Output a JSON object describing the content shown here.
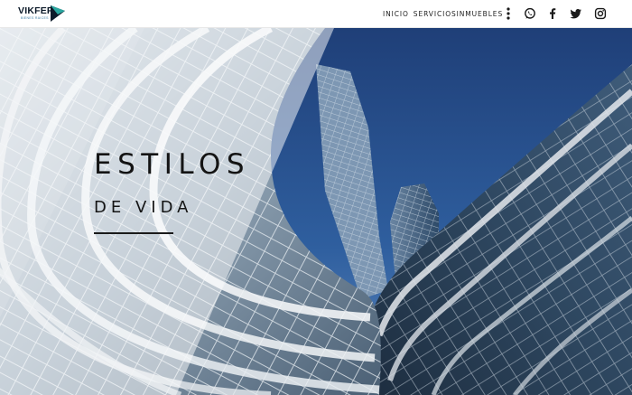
{
  "header": {
    "logo_text": "VIKFER",
    "logo_tagline": "BIENES RAICES",
    "nav": {
      "inicio": "INICIO",
      "servicios": "SERVICIOS",
      "inmuebles": "INMUEBLES"
    },
    "icons": {
      "menu": "kebab-menu-icon",
      "whatsapp": "whatsapp-icon",
      "facebook": "facebook-icon",
      "twitter": "twitter-icon",
      "instagram": "instagram-icon"
    }
  },
  "hero": {
    "title": "ESTILOS",
    "subtitle": "DE VIDA"
  },
  "colors": {
    "header_bg": "#ffffff",
    "text_dark": "#141414",
    "logo_accent": "#2aa7a0",
    "sky": "#2f5f9f"
  }
}
